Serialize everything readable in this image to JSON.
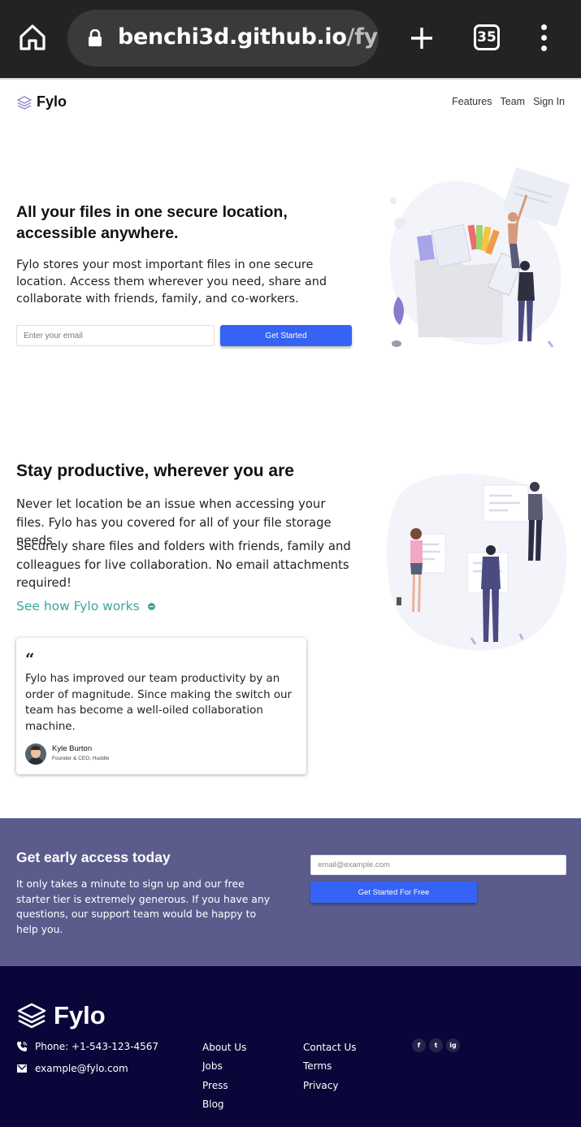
{
  "browser": {
    "url_host": "benchi3d.github.io",
    "url_path": "/fylo-",
    "tab_count": "35"
  },
  "nav": {
    "logo": "Fylo",
    "links": [
      "Features",
      "Team",
      "Sign In"
    ]
  },
  "hero": {
    "title": "All your files in one secure location, accessible anywhere.",
    "text": "Fylo stores your most important files in one secure location. Access them wherever you need, share and collaborate with friends, family, and co-workers.",
    "email_placeholder": "Enter your email",
    "button": "Get Started"
  },
  "productive": {
    "title": "Stay productive, wherever you are",
    "p1": "Never let location be an issue when accessing your files. Fylo has you covered for all of your file storage needs.",
    "p2": "Securely share files and folders with friends, family and colleagues for live collaboration. No email attachments required!",
    "link": "See how Fylo works"
  },
  "testimonial": {
    "quote_mark": "“",
    "text": "Fylo has improved our team productivity by an order of magnitude. Since making the switch our team has become a well-oiled collaboration machine.",
    "name": "Kyle Burton",
    "role": "Founder & CEO, Huddle"
  },
  "cta": {
    "title": "Get early access today",
    "text": "It only takes a minute to sign up and our free starter tier is extremely generous. If you have any questions, our support team would be happy to help you.",
    "email_placeholder": "email@example.com",
    "button": "Get Started For Free"
  },
  "footer": {
    "logo": "Fylo",
    "phone": "Phone: +1-543-123-4567",
    "email": "example@fylo.com",
    "col1": [
      "About Us",
      "Jobs",
      "Press",
      "Blog"
    ],
    "col2": [
      "Contact Us",
      "Terms",
      "Privacy"
    ],
    "social": [
      "f",
      "t",
      "ig"
    ]
  },
  "colors": {
    "accent_blue": "#3563f5",
    "teal_link": "#3aa699",
    "cta_bg": "#5b5c8c",
    "footer_bg": "#0b0639"
  }
}
